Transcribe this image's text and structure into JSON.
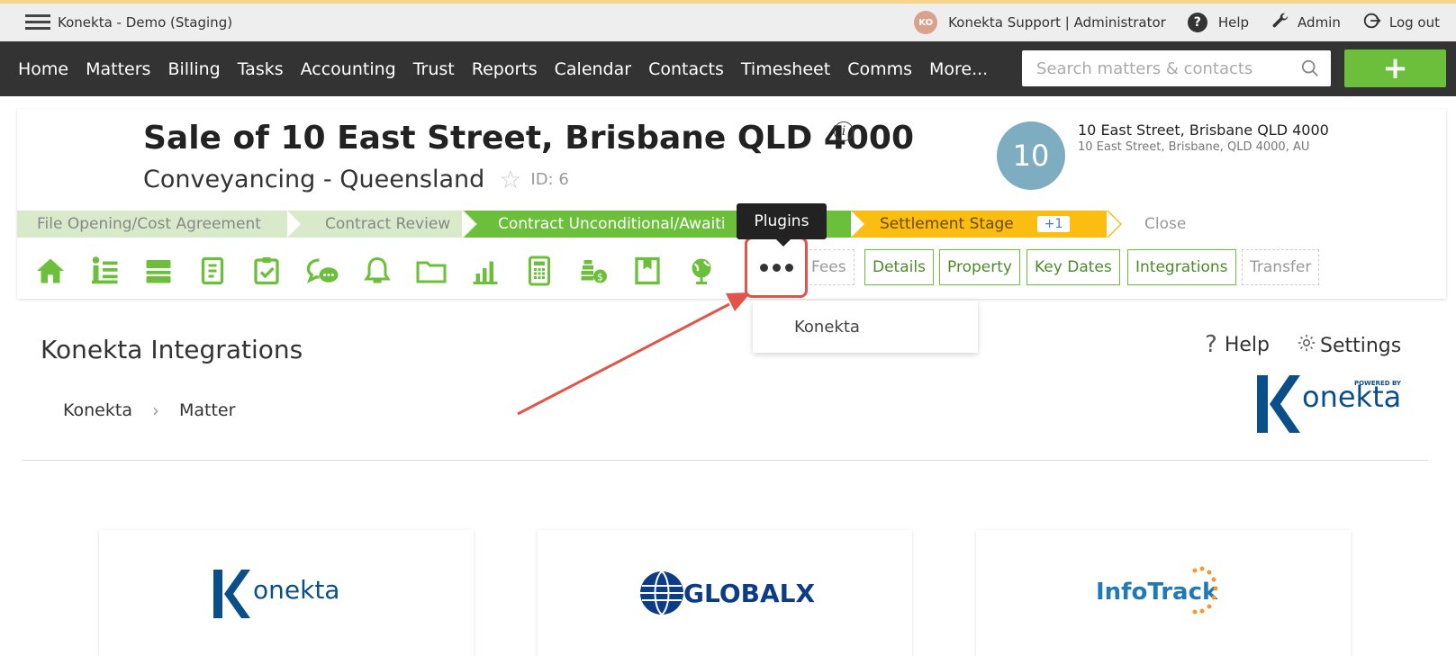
{
  "topbar": {
    "app_title": "Konekta - Demo (Staging)",
    "user_initials": "KO",
    "user_label": "Konekta Support | Administrator",
    "help_label": "Help",
    "admin_label": "Admin",
    "logout_label": "Log out"
  },
  "nav": {
    "items": [
      "Home",
      "Matters",
      "Billing",
      "Tasks",
      "Accounting",
      "Trust",
      "Reports",
      "Calendar",
      "Contacts",
      "Timesheet",
      "Comms",
      "More..."
    ],
    "search_placeholder": "Search matters & contacts",
    "add_label": "+"
  },
  "matter": {
    "title": "Sale of 10 East Street, Brisbane QLD 4000",
    "info_glyph": "i",
    "subtitle": "Conveyancing - Queensland",
    "id_label": "ID: 6",
    "number": "10",
    "address_line1": "10 East Street, Brisbane QLD 4000",
    "address_line2": "10 East Street, Brisbane, QLD 4000, AU"
  },
  "stages": [
    {
      "label": "File Opening/Cost Agreement",
      "state": "done"
    },
    {
      "label": "Contract Review",
      "state": "done"
    },
    {
      "label": "Contract Unconditional/Awaiti",
      "state": "active"
    },
    {
      "label": "Settlement Stage",
      "state": "warn",
      "badge": "+1"
    },
    {
      "label": "Close",
      "state": "pending"
    }
  ],
  "toolbar": {
    "icons": [
      "home-icon",
      "list-icon",
      "layers-icon",
      "document-icon",
      "checklist-icon",
      "chat-icon",
      "bell-icon",
      "folder-icon",
      "chart-icon",
      "calculator-icon",
      "coins-icon",
      "bookmark-icon",
      "globe-icon"
    ],
    "tabs": [
      "Fees",
      "Details",
      "Property",
      "Key Dates",
      "Integrations",
      "Transfer"
    ],
    "tooltip": "Plugins",
    "dropdown_item": "Konekta"
  },
  "integrations": {
    "title": "Konekta Integrations",
    "help_label": "Help",
    "settings_label": "Settings",
    "powered_by": "POWERED BY",
    "breadcrumb": [
      "Konekta",
      "Matter"
    ],
    "cards": [
      {
        "name": "Konekta",
        "logo": "onekta"
      },
      {
        "name": "GlobalX",
        "logo": "GLOBALX"
      },
      {
        "name": "InfoTrack",
        "logo": "InfoTrack"
      }
    ]
  },
  "colors": {
    "accent_green": "#6cbf3a",
    "nav_bg": "#333333",
    "stage_warn": "#fbbd11",
    "highlight_red": "#e0544a",
    "konekta_blue": "#0b4f8a"
  }
}
